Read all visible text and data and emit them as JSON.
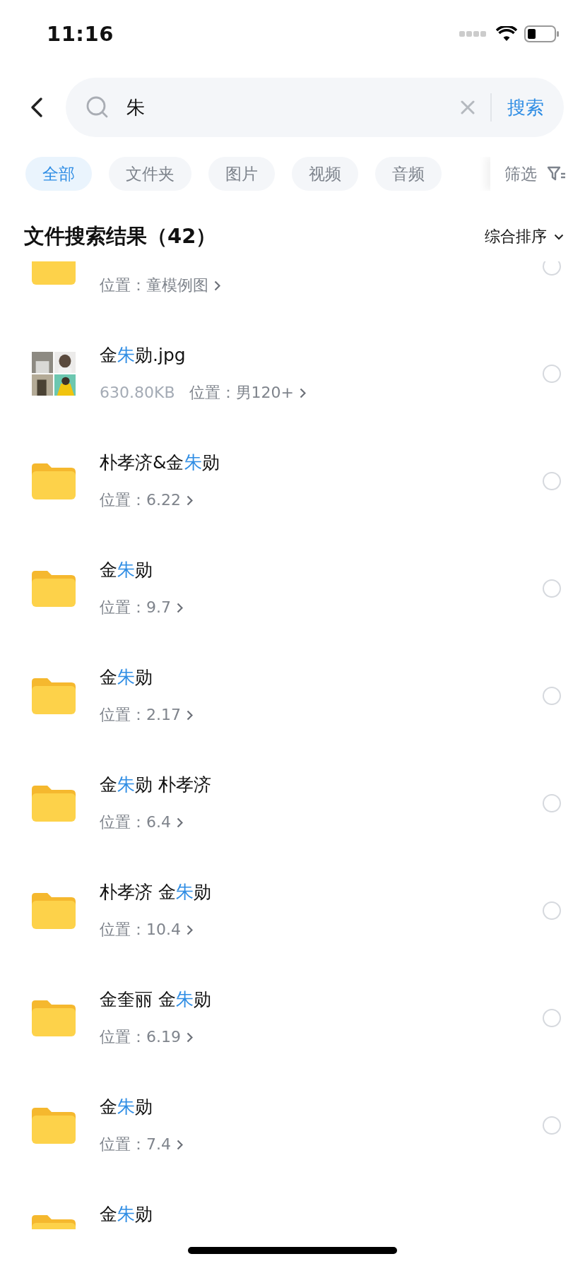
{
  "status_bar": {
    "time": "11:16"
  },
  "search": {
    "value": "朱",
    "action": "搜索"
  },
  "chips": [
    {
      "label": "全部",
      "selected": true
    },
    {
      "label": "文件夹",
      "selected": false
    },
    {
      "label": "图片",
      "selected": false
    },
    {
      "label": "视频",
      "selected": false
    },
    {
      "label": "音频",
      "selected": false
    }
  ],
  "filter": {
    "label": "筛选"
  },
  "results_header": {
    "title": "文件搜索结果（42）",
    "sort": "综合排序"
  },
  "results": [
    {
      "kind": "folder",
      "location": "位置：童模例图",
      "selected": false
    },
    {
      "title": [
        {
          "text": "金",
          "highlight": false
        },
        {
          "text": "朱",
          "highlight": true
        },
        {
          "text": "勋.jpg",
          "highlight": false
        }
      ],
      "size": "630.80KB",
      "location": "位置：男120+",
      "selected": false
    },
    {
      "kind": "folder",
      "title": [
        {
          "text": "朴孝济&金",
          "highlight": false
        },
        {
          "text": "朱",
          "highlight": true
        },
        {
          "text": "勋",
          "highlight": false
        }
      ],
      "location": "位置：6.22",
      "selected": false
    },
    {
      "kind": "folder",
      "title": [
        {
          "text": "金",
          "highlight": false
        },
        {
          "text": "朱",
          "highlight": true
        },
        {
          "text": "勋",
          "highlight": false
        }
      ],
      "location": "位置：9.7",
      "selected": false
    },
    {
      "kind": "folder",
      "title": [
        {
          "text": "金",
          "highlight": false
        },
        {
          "text": "朱",
          "highlight": true
        },
        {
          "text": "勋",
          "highlight": false
        }
      ],
      "location": "位置：2.17",
      "selected": false
    },
    {
      "kind": "folder",
      "title": [
        {
          "text": "金",
          "highlight": false
        },
        {
          "text": "朱",
          "highlight": true
        },
        {
          "text": "勋 朴孝济",
          "highlight": false
        }
      ],
      "location": "位置：6.4",
      "selected": false
    },
    {
      "kind": "folder",
      "title": [
        {
          "text": "朴孝济 金",
          "highlight": false
        },
        {
          "text": "朱",
          "highlight": true
        },
        {
          "text": "勋",
          "highlight": false
        }
      ],
      "location": "位置：10.4",
      "selected": false
    },
    {
      "kind": "folder",
      "title": [
        {
          "text": "金奎丽 金",
          "highlight": false
        },
        {
          "text": "朱",
          "highlight": true
        },
        {
          "text": "勋",
          "highlight": false
        }
      ],
      "location": "位置：6.19",
      "selected": false
    },
    {
      "kind": "folder",
      "title": [
        {
          "text": "金",
          "highlight": false
        },
        {
          "text": "朱",
          "highlight": true
        },
        {
          "text": "勋",
          "highlight": false
        }
      ],
      "location": "位置：7.4",
      "selected": false
    },
    {
      "kind": "folder",
      "title": [
        {
          "text": "金",
          "highlight": false
        },
        {
          "text": "朱",
          "highlight": true
        },
        {
          "text": "勋",
          "highlight": false
        }
      ]
    }
  ]
}
